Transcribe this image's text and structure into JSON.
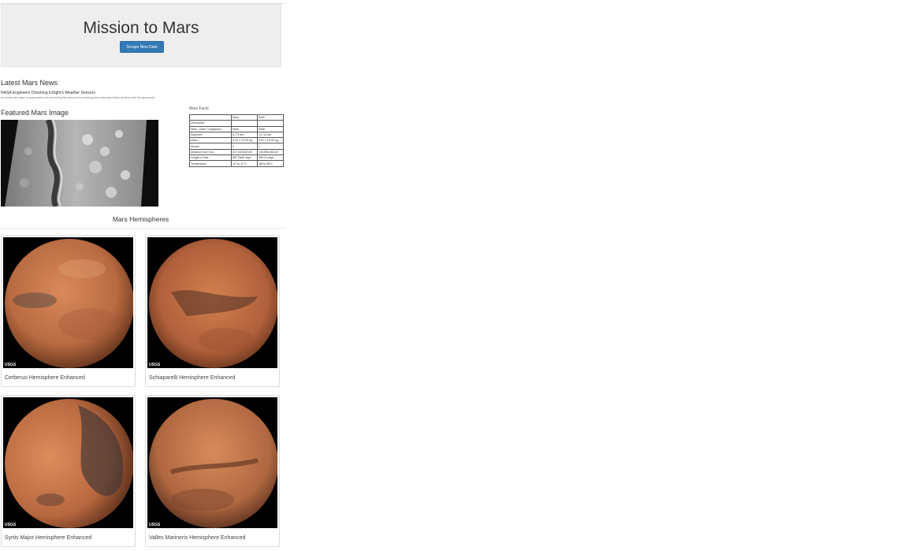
{
  "header": {
    "title": "Mission to Mars",
    "button_label": "Scrape New Data"
  },
  "news": {
    "heading": "Latest Mars News",
    "title": "NASA Engineers Checking InSight's Weather Sensors",
    "teaser": "An electronics issue is suspected to be preventing the sensors from sharing their data about Mars weather with the spacecraft."
  },
  "featured": {
    "heading": "Featured Mars Image"
  },
  "facts": {
    "caption": "Mars Facts",
    "columns": [
      "",
      "Mars",
      "Earth"
    ],
    "rows": [
      [
        "Description",
        "",
        ""
      ],
      [
        "Mars - Earth Comparison",
        "Mars",
        "Earth"
      ],
      [
        "Diameter:",
        "6,779 km",
        "12,742 km"
      ],
      [
        "Mass:",
        "6.39 × 10^23 kg",
        "5.97 × 10^24 kg"
      ],
      [
        "Moons:",
        "2",
        "1"
      ],
      [
        "Distance from Sun:",
        "227,943,824 km",
        "149,598,262 km"
      ],
      [
        "Length of Year:",
        "687 Earth days",
        "365.24 days"
      ],
      [
        "Temperature:",
        "-87 to -5 °C",
        "-88 to 58°C"
      ]
    ]
  },
  "hemispheres": {
    "heading": "Mars Hemispheres",
    "logo_text": "USGS",
    "items": [
      {
        "title": "Cerberus Hemisphere Enhanced"
      },
      {
        "title": "Schiaparelli Hemisphere Enhanced"
      },
      {
        "title": "Syrtis Major Hemisphere Enhanced"
      },
      {
        "title": "Valles Marineris Hemisphere Enhanced"
      }
    ]
  },
  "colors": {
    "primary_button": "#337ab7",
    "jumbotron_bg": "#eeeeee"
  }
}
